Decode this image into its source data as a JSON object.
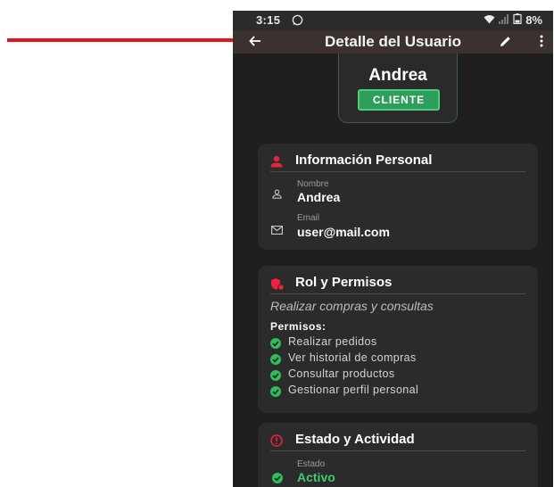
{
  "status_bar": {
    "time": "3:15",
    "battery": "8%"
  },
  "app_bar": {
    "title": "Detalle del Usuario"
  },
  "header": {
    "name": "Andrea",
    "role_badge": "CLIENTE"
  },
  "personal_info": {
    "title": "Información Personal",
    "name_label": "Nombre",
    "name_value": "Andrea",
    "email_label": "Email",
    "email_value": "user@mail.com"
  },
  "roles": {
    "title": "Rol y Permisos",
    "description": "Realizar compras y consultas",
    "permissions_title": "Permisos:",
    "permissions": [
      "Realizar pedidos",
      "Ver historial de compras",
      "Consultar productos",
      "Gestionar perfil personal"
    ]
  },
  "status_section": {
    "title": "Estado y Actividad",
    "status_label": "Estado",
    "status_value": "Activo"
  },
  "colors": {
    "accent_red": "#e8243c",
    "success_green": "#2e9e5b",
    "arrow_red": "#e8141c"
  }
}
